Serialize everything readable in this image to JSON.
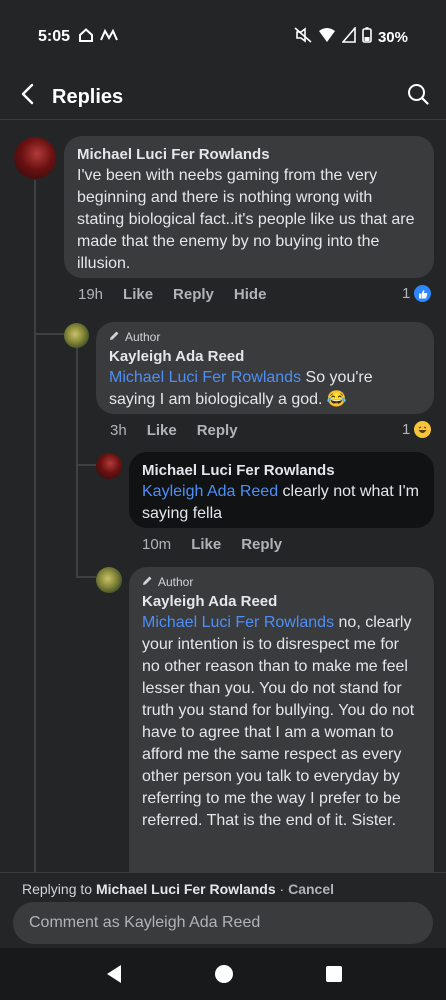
{
  "status_bar": {
    "time": "5:05",
    "battery": "30%",
    "icons": [
      "home-outline-icon",
      "signal-m-icon",
      "mute-icon",
      "wifi-icon",
      "cell-signal-icon",
      "battery-icon"
    ]
  },
  "header": {
    "title": "Replies",
    "back_icon": "chevron-left-icon",
    "search_icon": "search-icon"
  },
  "comments": [
    {
      "author": "Michael Luci Fer Rowlands",
      "text": "I've been with neebs gaming from the very beginning and there is nothing wrong with stating biological fact..it's people like us that are made that the enemy by no buying into the illusion.",
      "time": "19h",
      "like_label": "Like",
      "reply_label": "Reply",
      "hide_label": "Hide",
      "reaction_count": "1",
      "reaction_icon": "like-reaction-icon"
    },
    {
      "badge": "Author",
      "author": "Kayleigh Ada Reed",
      "mention": "Michael Luci Fer Rowlands",
      "text": " So you're saying I am biologically a god. 😂",
      "time": "3h",
      "like_label": "Like",
      "reply_label": "Reply",
      "reaction_count": "1",
      "reaction_icon": "haha-reaction-icon"
    },
    {
      "author": "Michael Luci Fer Rowlands",
      "mention": "Kayleigh Ada Reed",
      "text": " clearly not what I'm saying fella",
      "time": "10m",
      "like_label": "Like",
      "reply_label": "Reply"
    },
    {
      "badge": "Author",
      "author": "Kayleigh Ada Reed",
      "mention": "Michael Luci Fer Rowlands",
      "text": " no, clearly your intention is to disrespect me for no other reason than to make me feel lesser than you. You do not stand for truth you stand for bullying. You do not have to agree that I am a woman to afford me the same respect as every other person you talk to everyday by referring to me the way I prefer to be referred. That is the end of it. Sister."
    }
  ],
  "reply_bar": {
    "replying_prefix": "Replying to ",
    "replying_name": "Michael Luci Fer Rowlands",
    "separator": " · ",
    "cancel_label": "Cancel",
    "input_placeholder": "Comment as Kayleigh Ada Reed"
  },
  "nav_bar": {
    "icons": [
      "nav-back-icon",
      "nav-home-icon",
      "nav-recents-icon"
    ]
  }
}
